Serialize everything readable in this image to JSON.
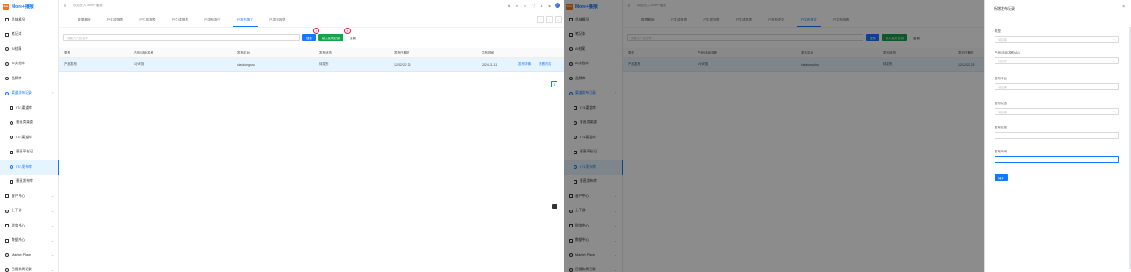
{
  "app": {
    "logo_mark": "Ros",
    "title": "More+播报",
    "welcome": "欢迎进入 More+播报"
  },
  "sidebar": {
    "items": [
      {
        "label": "总体概况",
        "icon": "sq"
      },
      {
        "label": "笔记本",
        "icon": "sq"
      },
      {
        "label": "AI档案",
        "icon": "ci"
      },
      {
        "label": "AI文档库",
        "icon": "ci"
      },
      {
        "label": "品牌库",
        "icon": "ci"
      },
      {
        "label": "渠道发布记录",
        "icon": "ci",
        "open": true
      },
      {
        "label": "IT/1渠道库",
        "icon": "sq",
        "sub": true
      },
      {
        "label": "垂直类渠道",
        "icon": "ci",
        "sub": true
      },
      {
        "label": "IT/1渠道库",
        "icon": "ci",
        "sub": true
      },
      {
        "label": "垂直平台记",
        "icon": "sq",
        "sub": true
      },
      {
        "label": "IT/1发布库",
        "icon": "ci",
        "sub": true,
        "active": true
      },
      {
        "label": "垂直发布库",
        "icon": "sq",
        "sub": true
      },
      {
        "label": "客户中心",
        "icon": "sq",
        "chev": true
      },
      {
        "label": "上下游",
        "icon": "ci",
        "chev": true
      },
      {
        "label": "财务中心",
        "icon": "sq",
        "chev": true
      },
      {
        "label": "数据中心",
        "icon": "sq",
        "chev": true
      },
      {
        "label": "Market Place",
        "icon": "ci",
        "chev": true
      },
      {
        "label": "日报和周记录",
        "icon": "ci",
        "chev": true
      }
    ]
  },
  "topbar": {
    "icons": [
      "A",
      "⌕",
      "⌂",
      "⛶",
      "A",
      "⇆"
    ]
  },
  "tabs": [
    "数据看板",
    "已生成报表",
    "已生成报表",
    "已生成报表",
    "已发布报文",
    "已发布报文",
    "已发布报表"
  ],
  "tab_ctrl": [
    "|",
    "‹",
    "›"
  ],
  "filter": {
    "placeholder": "请输入产品名称",
    "search": "搜索",
    "import": "录入发布记录",
    "reset": "重置"
  },
  "markers": [
    "①",
    "②",
    "③",
    "④"
  ],
  "table": {
    "headers": [
      "类型",
      "产品/活动名称",
      "发布平台",
      "发布状态",
      "发布日期时",
      "发布时间"
    ],
    "row": [
      "产品发布",
      "1小时前",
      "xiaohongshu",
      "待发布",
      "12/12/22 23",
      "2024-11-11"
    ],
    "actions": [
      "发布详情",
      "查看内容"
    ],
    "page": "1"
  },
  "drawer": {
    "title": "新增发布记录",
    "close": "×",
    "fields": [
      {
        "label": "类型",
        "placeholder": "请选择"
      },
      {
        "label": "产品/活动名称(AI)",
        "placeholder": "请选择"
      },
      {
        "label": "发布平台",
        "placeholder": "请选择"
      },
      {
        "label": "发布状态",
        "placeholder": "请选择"
      },
      {
        "label": "发布链接",
        "placeholder": ""
      },
      {
        "label": "发布时间",
        "placeholder": ""
      }
    ],
    "save": "保存"
  }
}
